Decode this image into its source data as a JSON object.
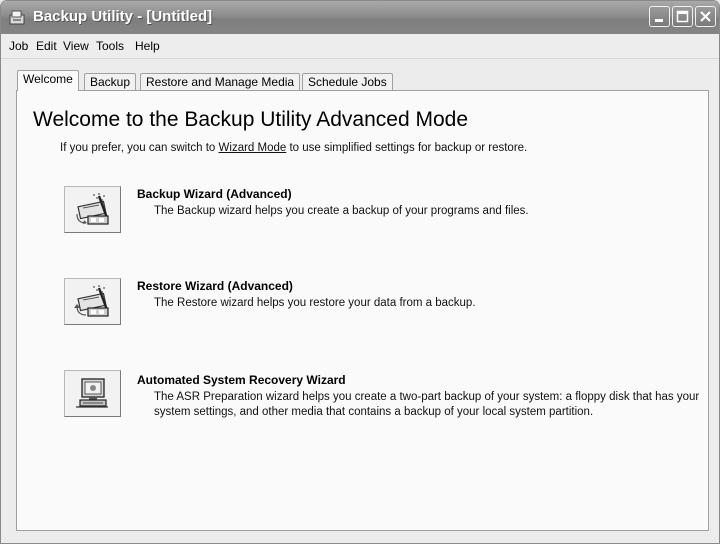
{
  "window": {
    "title": "Backup Utility - [Untitled]"
  },
  "menu": [
    "Job",
    "Edit",
    "View",
    "Tools",
    "Help"
  ],
  "tabs": [
    "Welcome",
    "Backup",
    "Restore and Manage Media",
    "Schedule Jobs"
  ],
  "active_tab": "Welcome",
  "welcome": {
    "heading": "Welcome to the Backup Utility Advanced Mode",
    "intro_before": "If you prefer, you can switch to ",
    "intro_link": "Wizard Mode",
    "intro_after": " to use simplified settings for backup or restore."
  },
  "wizards": [
    {
      "icon": "backup-wizard-icon",
      "title": "Backup Wizard (Advanced)",
      "description": "The Backup wizard helps you create a backup of your programs and files."
    },
    {
      "icon": "restore-wizard-icon",
      "title": "Restore Wizard (Advanced)",
      "description": "The Restore wizard helps you restore your data from a backup."
    },
    {
      "icon": "asr-wizard-icon",
      "title": "Automated System Recovery Wizard",
      "description": "The ASR Preparation wizard helps you create a two-part backup of your system: a floppy disk that has your system settings, and other media that contains a backup of your local system partition."
    }
  ]
}
